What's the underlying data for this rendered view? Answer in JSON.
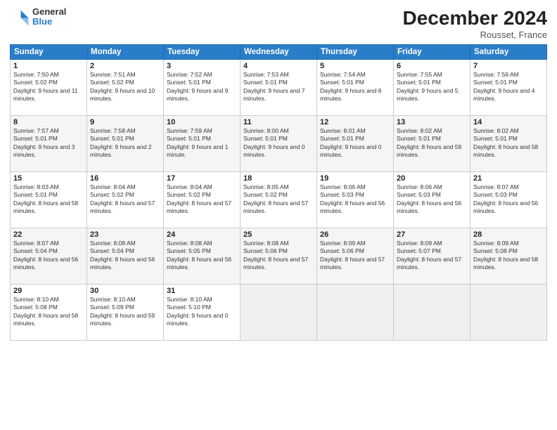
{
  "logo": {
    "general": "General",
    "blue": "Blue"
  },
  "title": "December 2024",
  "location": "Rousset, France",
  "days_of_week": [
    "Sunday",
    "Monday",
    "Tuesday",
    "Wednesday",
    "Thursday",
    "Friday",
    "Saturday"
  ],
  "weeks": [
    [
      {
        "day": "1",
        "sunrise": "7:50 AM",
        "sunset": "5:02 PM",
        "daylight": "9 hours and 11 minutes."
      },
      {
        "day": "2",
        "sunrise": "7:51 AM",
        "sunset": "5:02 PM",
        "daylight": "9 hours and 10 minutes."
      },
      {
        "day": "3",
        "sunrise": "7:52 AM",
        "sunset": "5:01 PM",
        "daylight": "9 hours and 9 minutes."
      },
      {
        "day": "4",
        "sunrise": "7:53 AM",
        "sunset": "5:01 PM",
        "daylight": "9 hours and 7 minutes."
      },
      {
        "day": "5",
        "sunrise": "7:54 AM",
        "sunset": "5:01 PM",
        "daylight": "9 hours and 6 minutes."
      },
      {
        "day": "6",
        "sunrise": "7:55 AM",
        "sunset": "5:01 PM",
        "daylight": "9 hours and 5 minutes."
      },
      {
        "day": "7",
        "sunrise": "7:56 AM",
        "sunset": "5:01 PM",
        "daylight": "9 hours and 4 minutes."
      }
    ],
    [
      {
        "day": "8",
        "sunrise": "7:57 AM",
        "sunset": "5:01 PM",
        "daylight": "9 hours and 3 minutes."
      },
      {
        "day": "9",
        "sunrise": "7:58 AM",
        "sunset": "5:01 PM",
        "daylight": "9 hours and 2 minutes."
      },
      {
        "day": "10",
        "sunrise": "7:59 AM",
        "sunset": "5:01 PM",
        "daylight": "9 hours and 1 minute."
      },
      {
        "day": "11",
        "sunrise": "8:00 AM",
        "sunset": "5:01 PM",
        "daylight": "9 hours and 0 minutes."
      },
      {
        "day": "12",
        "sunrise": "8:01 AM",
        "sunset": "5:01 PM",
        "daylight": "9 hours and 0 minutes."
      },
      {
        "day": "13",
        "sunrise": "8:02 AM",
        "sunset": "5:01 PM",
        "daylight": "8 hours and 59 minutes."
      },
      {
        "day": "14",
        "sunrise": "8:02 AM",
        "sunset": "5:01 PM",
        "daylight": "8 hours and 58 minutes."
      }
    ],
    [
      {
        "day": "15",
        "sunrise": "8:03 AM",
        "sunset": "5:01 PM",
        "daylight": "8 hours and 58 minutes."
      },
      {
        "day": "16",
        "sunrise": "8:04 AM",
        "sunset": "5:02 PM",
        "daylight": "8 hours and 57 minutes."
      },
      {
        "day": "17",
        "sunrise": "8:04 AM",
        "sunset": "5:02 PM",
        "daylight": "8 hours and 57 minutes."
      },
      {
        "day": "18",
        "sunrise": "8:05 AM",
        "sunset": "5:02 PM",
        "daylight": "8 hours and 57 minutes."
      },
      {
        "day": "19",
        "sunrise": "8:06 AM",
        "sunset": "5:03 PM",
        "daylight": "8 hours and 56 minutes."
      },
      {
        "day": "20",
        "sunrise": "8:06 AM",
        "sunset": "5:03 PM",
        "daylight": "8 hours and 56 minutes."
      },
      {
        "day": "21",
        "sunrise": "8:07 AM",
        "sunset": "5:03 PM",
        "daylight": "8 hours and 56 minutes."
      }
    ],
    [
      {
        "day": "22",
        "sunrise": "8:07 AM",
        "sunset": "5:04 PM",
        "daylight": "8 hours and 56 minutes."
      },
      {
        "day": "23",
        "sunrise": "8:08 AM",
        "sunset": "5:04 PM",
        "daylight": "8 hours and 56 minutes."
      },
      {
        "day": "24",
        "sunrise": "8:08 AM",
        "sunset": "5:05 PM",
        "daylight": "8 hours and 56 minutes."
      },
      {
        "day": "25",
        "sunrise": "8:08 AM",
        "sunset": "5:06 PM",
        "daylight": "8 hours and 57 minutes."
      },
      {
        "day": "26",
        "sunrise": "8:09 AM",
        "sunset": "5:06 PM",
        "daylight": "8 hours and 57 minutes."
      },
      {
        "day": "27",
        "sunrise": "8:09 AM",
        "sunset": "5:07 PM",
        "daylight": "8 hours and 57 minutes."
      },
      {
        "day": "28",
        "sunrise": "8:09 AM",
        "sunset": "5:08 PM",
        "daylight": "8 hours and 58 minutes."
      }
    ],
    [
      {
        "day": "29",
        "sunrise": "8:10 AM",
        "sunset": "5:08 PM",
        "daylight": "8 hours and 58 minutes."
      },
      {
        "day": "30",
        "sunrise": "8:10 AM",
        "sunset": "5:09 PM",
        "daylight": "8 hours and 59 minutes."
      },
      {
        "day": "31",
        "sunrise": "8:10 AM",
        "sunset": "5:10 PM",
        "daylight": "9 hours and 0 minutes."
      },
      null,
      null,
      null,
      null
    ]
  ]
}
